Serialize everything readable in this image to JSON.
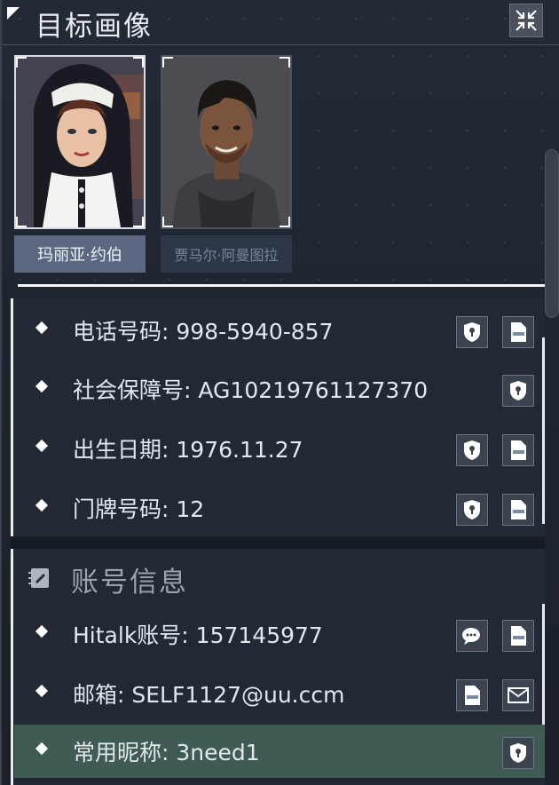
{
  "header": {
    "title": "目标画像"
  },
  "targets": [
    {
      "name": "玛丽亚·约伯",
      "selected": true
    },
    {
      "name": "贾马尔·阿曼图拉",
      "selected": false
    }
  ],
  "personal_info": [
    {
      "label": "电话号码",
      "value": "998-5940-857",
      "icons": [
        "shield-icon",
        "document-icon"
      ]
    },
    {
      "label": "社会保障号",
      "value": "AG10219761127370",
      "icons": [
        "shield-icon"
      ]
    },
    {
      "label": "出生日期",
      "value": "1976.11.27",
      "icons": [
        "shield-icon",
        "document-icon"
      ]
    },
    {
      "label": "门牌号码",
      "value": "12",
      "icons": [
        "shield-icon",
        "document-icon"
      ]
    }
  ],
  "account_section": {
    "title": "账号信息",
    "icon": "notebook-icon"
  },
  "account_info": [
    {
      "label": "Hitalk账号",
      "value": "157145977",
      "icons": [
        "chat-icon",
        "document-icon"
      ]
    },
    {
      "label": "邮箱",
      "value": "SELF1127@uu.ccm",
      "icons": [
        "document-icon",
        "mail-icon"
      ]
    },
    {
      "label": "常用昵称",
      "value": "3need1",
      "icons": [
        "shield-icon"
      ],
      "highlighted": true
    }
  ],
  "colors": {
    "background": "#1b2029",
    "selected_tab": "#5c6882",
    "highlight_row": "#3f5b54",
    "text": "#e3e7ee"
  }
}
